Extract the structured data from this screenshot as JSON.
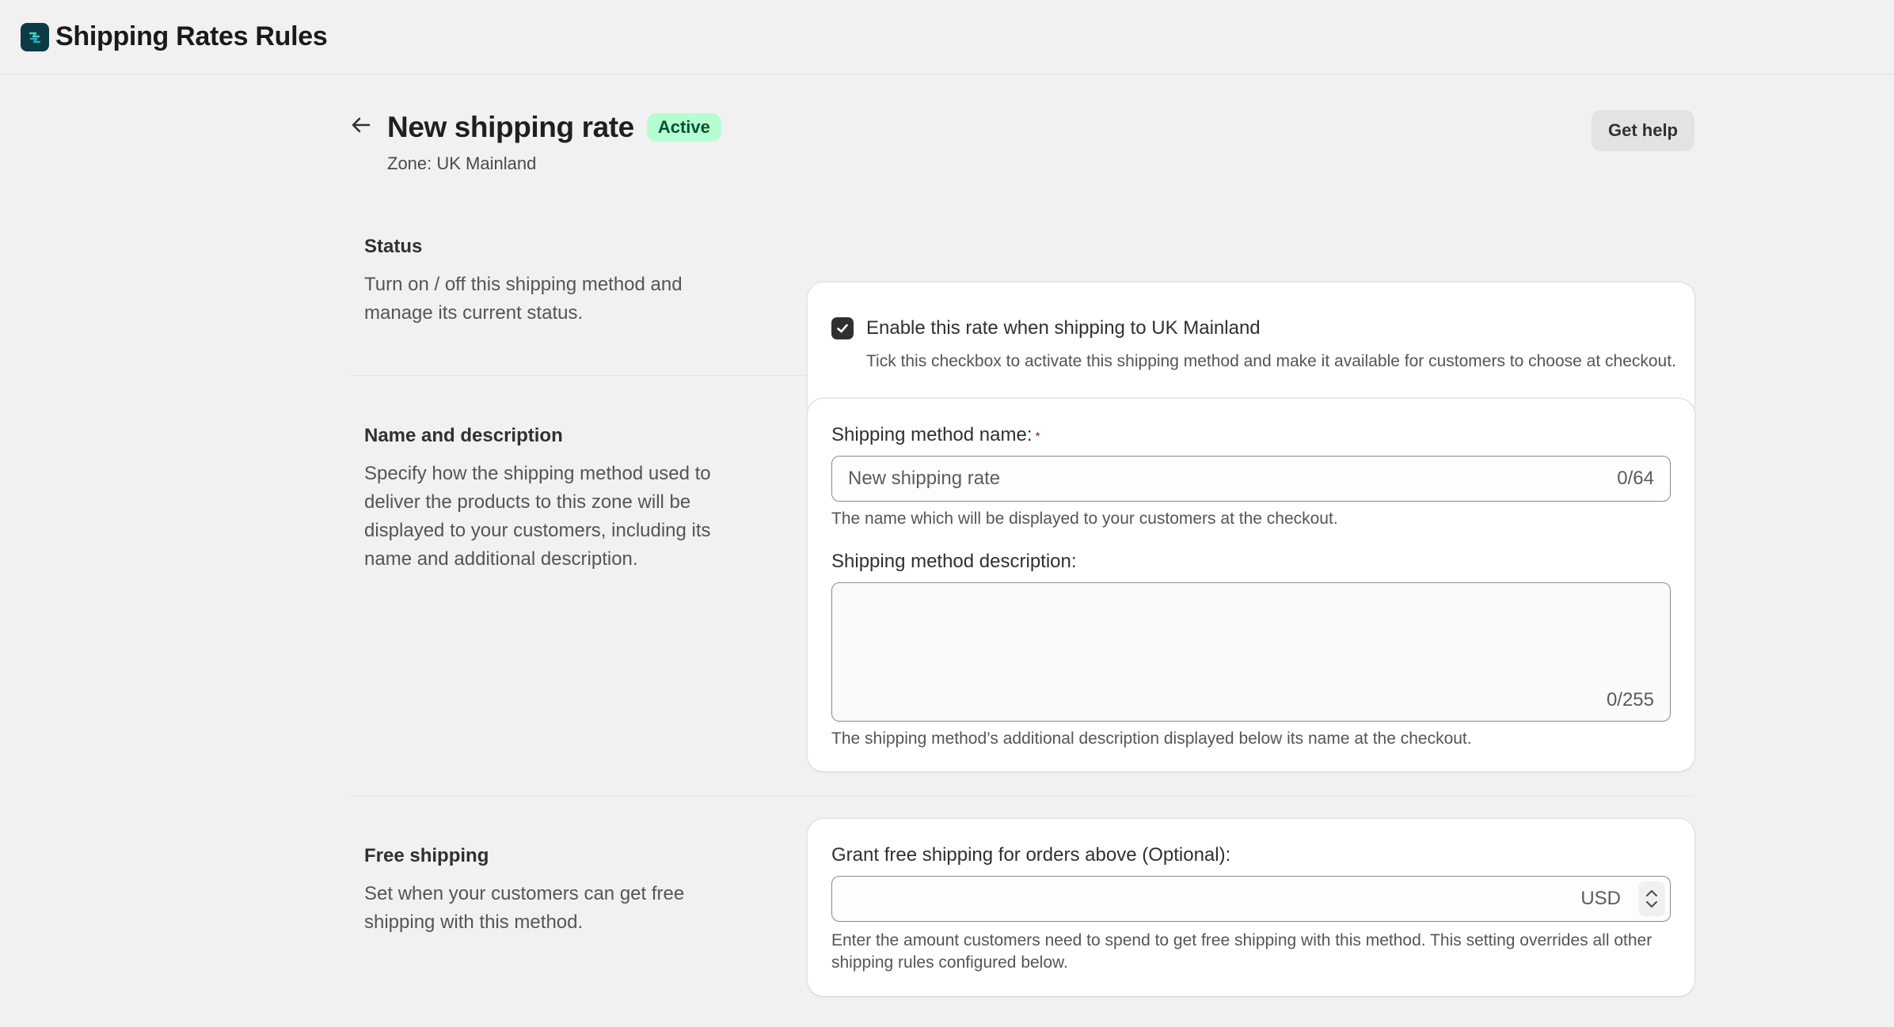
{
  "app": {
    "title": "Shipping Rates Rules"
  },
  "header": {
    "title": "New shipping rate",
    "badge": "Active",
    "subtitle": "Zone: UK Mainland",
    "help_label": "Get help"
  },
  "status": {
    "heading": "Status",
    "description": "Turn on / off this shipping method and manage its current status.",
    "checkbox_label": "Enable this rate when shipping to UK Mainland",
    "checkbox_checked": true,
    "help": "Tick this checkbox to activate this shipping method and make it available for customers to choose at checkout."
  },
  "name_description": {
    "heading": "Name and description",
    "description": "Specify how the shipping method used to deliver the products to this zone will be displayed to your customers, including its name and additional description.",
    "name_label": "Shipping method name:",
    "required_mark": "*",
    "name_placeholder": "New shipping rate",
    "name_counter": "0/64",
    "name_help": "The name which will be displayed to your customers at the checkout.",
    "desc_label": "Shipping method description:",
    "desc_counter": "0/255",
    "desc_help": "The shipping method’s additional description displayed below its name at the checkout."
  },
  "free_shipping": {
    "heading": "Free shipping",
    "description": "Set when your customers can get free shipping with this method.",
    "field_label": "Grant free shipping for orders above (Optional):",
    "currency": "USD",
    "help": "Enter the amount customers need to spend to get free shipping with this method. This setting overrides all other shipping rules configured below."
  },
  "colors": {
    "background": "#f1f1f1",
    "badge_bg": "#b4fed2",
    "badge_text": "#0c5132",
    "required": "#8e1f0b",
    "logo": "#0c3a45"
  }
}
